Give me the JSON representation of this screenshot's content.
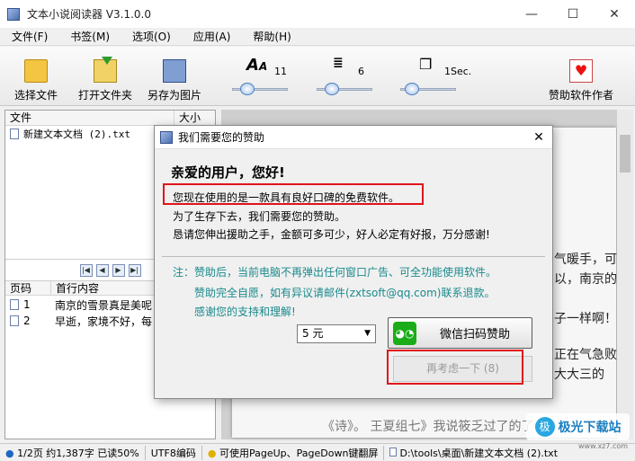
{
  "window": {
    "title": "文本小说阅读器 V3.1.0.0",
    "minimize_icon": "—",
    "maximize_icon": "☐",
    "close_icon": "✕"
  },
  "menu": [
    "文件(F)",
    "书签(M)",
    "选项(O)",
    "应用(A)",
    "帮助(H)"
  ],
  "toolbar": {
    "choose_file": "选择文件",
    "open_folder": "打开文件夹",
    "save_image": "另存为图片",
    "font_size_value": "11",
    "line_space_value": "6",
    "scroll_speed_value": "1Sec.",
    "sponsor": "赞助软件作者"
  },
  "sliders": {
    "font_size_level": 0.2,
    "line_space_level": 0.2,
    "speed_level": 0.1
  },
  "file_list": {
    "col_file": "文件",
    "col_size": "大小",
    "files": [
      "新建文本文档 (2).txt"
    ]
  },
  "nav_buttons": [
    "|◀",
    "◀",
    "▶",
    "▶|"
  ],
  "pages": {
    "col_page": "页码",
    "col_content": "首行内容",
    "rows": [
      {
        "page": "1",
        "content": "南京的雪景真是美呢"
      },
      {
        "page": "2",
        "content": "早逝，家境不好，每"
      }
    ]
  },
  "reader": {
    "lines": [
      "气暖手，可",
      "以，南京的",
      "子一样啊！",
      "正在气急败",
      "大大三的",
      "《诗》。 王夏组七》我说筱乏过了的了"
    ]
  },
  "statusbar": {
    "pages": "1/2页 约1,387字 已读50%",
    "encoding": "UTF8编码",
    "tip": "可使用PageUp、PageDown键翻屏",
    "path": "D:\\tools\\桌面\\新建文本文档 (2).txt"
  },
  "watermark": {
    "logo": "极",
    "text": "极光下载站",
    "sub": "www.xz7.com"
  },
  "dialog": {
    "title": "我们需要您的赞助",
    "heading": "亲爱的用户，您好!",
    "line1": "您现在使用的是一款具有良好口碑的免费软件。",
    "line2": "为了生存下去，我们需要您的赞助。",
    "line3": "恳请您伸出援助之手，金额可多可少，好人必定有好报，万分感谢!",
    "note1": "注：赞助后，当前电脑不再弹出任何窗口广告、可全功能使用软件。",
    "note2": "赞助完全自愿，如有异议请邮件(zxtsoft@qq.com)联系退款。",
    "note3": "感谢您的支持和理解!",
    "amount": "5 元",
    "wechat_button": "微信扫码赞助",
    "later_button": "再考虑一下 (8)",
    "close_icon": "✕"
  },
  "colors": {
    "highlight": "#e0141a",
    "note": "#1a8a8c",
    "wechat": "#1aad19"
  }
}
